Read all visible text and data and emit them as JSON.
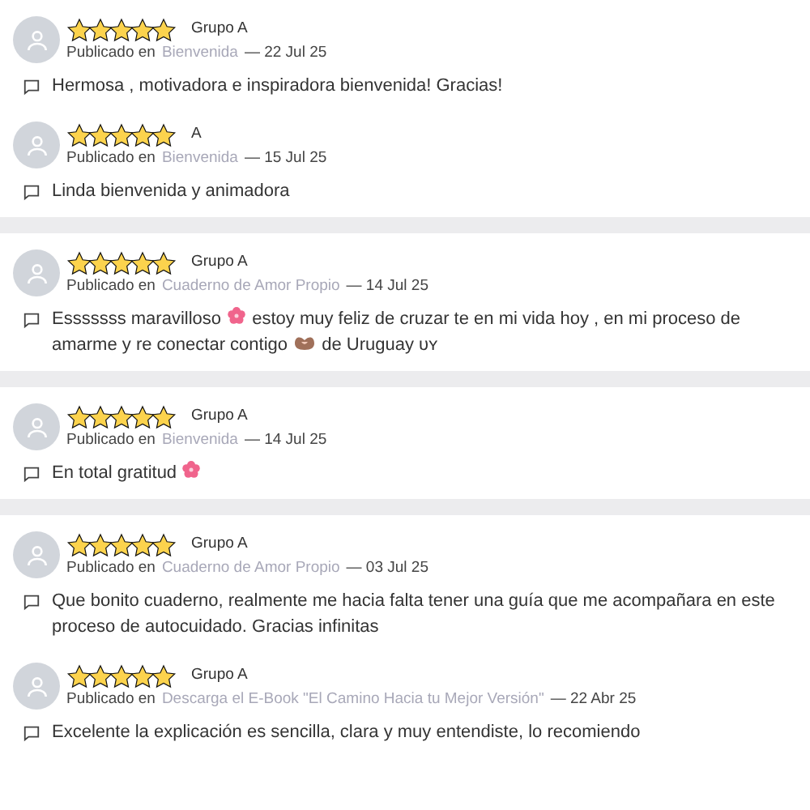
{
  "cards": [
    {
      "reviews": [
        {
          "stars": 5,
          "group": "Grupo A",
          "posted_label": "Publicado en",
          "place": "Bienvenida",
          "date": "— 22 Jul 25",
          "comment": [
            {
              "kind": "text",
              "text": "Hermosa , motivadora e inspiradora bienvenida! Gracias!"
            }
          ]
        },
        {
          "stars": 5,
          "group": "A",
          "posted_label": "Publicado en",
          "place": "Bienvenida",
          "date": "— 15 Jul 25",
          "comment": [
            {
              "kind": "text",
              "text": "Linda bienvenida y animadora"
            }
          ]
        }
      ]
    },
    {
      "reviews": [
        {
          "stars": 5,
          "group": "Grupo A",
          "posted_label": "Publicado en",
          "place": "Cuaderno de Amor Propio",
          "date": "— 14 Jul 25",
          "comment": [
            {
              "kind": "text",
              "text": "Esssssss maravilloso"
            },
            {
              "kind": "flower"
            },
            {
              "kind": "text",
              "text": "estoy muy feliz de cruzar te en mi vida hoy , en mi proceso de amarme y re conectar contigo"
            },
            {
              "kind": "hands"
            },
            {
              "kind": "text",
              "text": "de Uruguay ᴜʏ"
            }
          ]
        }
      ]
    },
    {
      "reviews": [
        {
          "stars": 5,
          "group": "Grupo A",
          "posted_label": "Publicado en",
          "place": "Bienvenida",
          "date": "— 14 Jul 25",
          "comment": [
            {
              "kind": "text",
              "text": "En total gratitud"
            },
            {
              "kind": "flower"
            }
          ]
        }
      ]
    },
    {
      "reviews": [
        {
          "stars": 5,
          "group": "Grupo A",
          "posted_label": "Publicado en",
          "place": "Cuaderno de Amor Propio",
          "date": "— 03 Jul 25",
          "comment": [
            {
              "kind": "text",
              "text": "Que bonito cuaderno, realmente me hacia falta tener una guía que me acompañara en este proceso de autocuidado. Gracias infinitas"
            }
          ]
        },
        {
          "stars": 5,
          "group": "Grupo A",
          "posted_label": "Publicado en",
          "place": "Descarga el E-Book \"El Camino Hacia tu Mejor Versión\"",
          "date": "— 22 Abr 25",
          "comment": [
            {
              "kind": "text",
              "text": "Excelente la explicación es sencilla, clara y muy entendiste, lo recomiendo"
            }
          ]
        }
      ]
    }
  ]
}
